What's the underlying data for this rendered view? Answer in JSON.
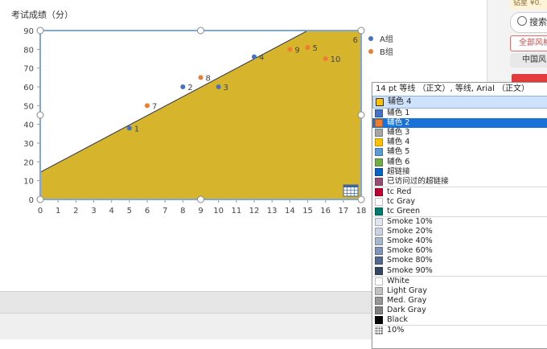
{
  "chart_data": {
    "type": "scatter",
    "title": "考试成绩（分）",
    "xlim": [
      0,
      18
    ],
    "ylim": [
      0,
      90
    ],
    "x_ticks": [
      0,
      1,
      2,
      3,
      4,
      5,
      6,
      7,
      8,
      9,
      10,
      11,
      12,
      13,
      14,
      15,
      16,
      17,
      18
    ],
    "y_ticks": [
      0,
      10,
      20,
      30,
      40,
      50,
      60,
      70,
      80,
      90
    ],
    "series": [
      {
        "name": "A组",
        "color": "#4472c4",
        "points": [
          {
            "x": 5,
            "y": 38,
            "label": "1"
          },
          {
            "x": 8,
            "y": 60,
            "label": "2"
          },
          {
            "x": 10,
            "y": 60,
            "label": "3"
          },
          {
            "x": 12,
            "y": 76,
            "label": "4"
          }
        ]
      },
      {
        "name": "B组",
        "color": "#ed7d31",
        "points": [
          {
            "x": 15,
            "y": 81,
            "label": "5"
          },
          {
            "x": 14,
            "y": 80,
            "label": "9"
          },
          {
            "x": 16,
            "y": 75,
            "label": "10"
          },
          {
            "x": 9,
            "y": 65,
            "label": "8"
          },
          {
            "x": 6,
            "y": 50,
            "label": "7"
          }
        ]
      }
    ],
    "extra_labels": [
      {
        "x": 17.8,
        "y": 87,
        "label": "6"
      }
    ],
    "trendline": {
      "x": [
        0,
        15
      ],
      "y": [
        14.5,
        90
      ]
    },
    "fill_color": "#d6b42c",
    "grid": false,
    "legend_position": "right"
  },
  "dropdown": {
    "header": "14 pt 等线 （正文）, 等线, Arial （正文）",
    "current": {
      "label": "辅色 4",
      "color": "#ffc000"
    },
    "items": [
      {
        "label": "辅色 1",
        "color": "#4472c4"
      },
      {
        "label": "辅色 2",
        "color": "#ed7d31",
        "selected": true
      },
      {
        "label": "辅色 3",
        "color": "#a5a5a5"
      },
      {
        "label": "辅色 4",
        "color": "#ffc000"
      },
      {
        "label": "辅色 5",
        "color": "#5b9bd5"
      },
      {
        "label": "辅色 6",
        "color": "#70ad47"
      },
      {
        "label": "超链接",
        "color": "#0563c1"
      },
      {
        "label": "已访问过的超链接",
        "color": "#954f72"
      },
      {
        "label": "tc Red",
        "color": "#c00030",
        "sep": true
      },
      {
        "label": "tc Gray",
        "color": "#ffffff"
      },
      {
        "label": "tc Green",
        "color": "#007a6e"
      },
      {
        "label": "Smoke 10%",
        "color": "#dfe6f0",
        "sep": true
      },
      {
        "label": "Smoke 20%",
        "color": "#c9d3e3"
      },
      {
        "label": "Smoke 40%",
        "color": "#a6b6cf"
      },
      {
        "label": "Smoke 60%",
        "color": "#7f94b8"
      },
      {
        "label": "Smoke 80%",
        "color": "#53698f"
      },
      {
        "label": "Smoke 90%",
        "color": "#364766"
      },
      {
        "label": "White",
        "color": "#ffffff",
        "sep": true
      },
      {
        "label": "Light Gray",
        "color": "#c0c0c0"
      },
      {
        "label": "Med. Gray",
        "color": "#969696"
      },
      {
        "label": "Dark Gray",
        "color": "#808080"
      },
      {
        "label": "Black",
        "color": "#000000"
      },
      {
        "label": "10%",
        "color": "pattern",
        "sep": true
      }
    ]
  },
  "side_panel": {
    "badge_text": "钻星 ¥0.",
    "search_label": "搜索",
    "all_label": "全部风格",
    "cn_label": "中国风"
  }
}
